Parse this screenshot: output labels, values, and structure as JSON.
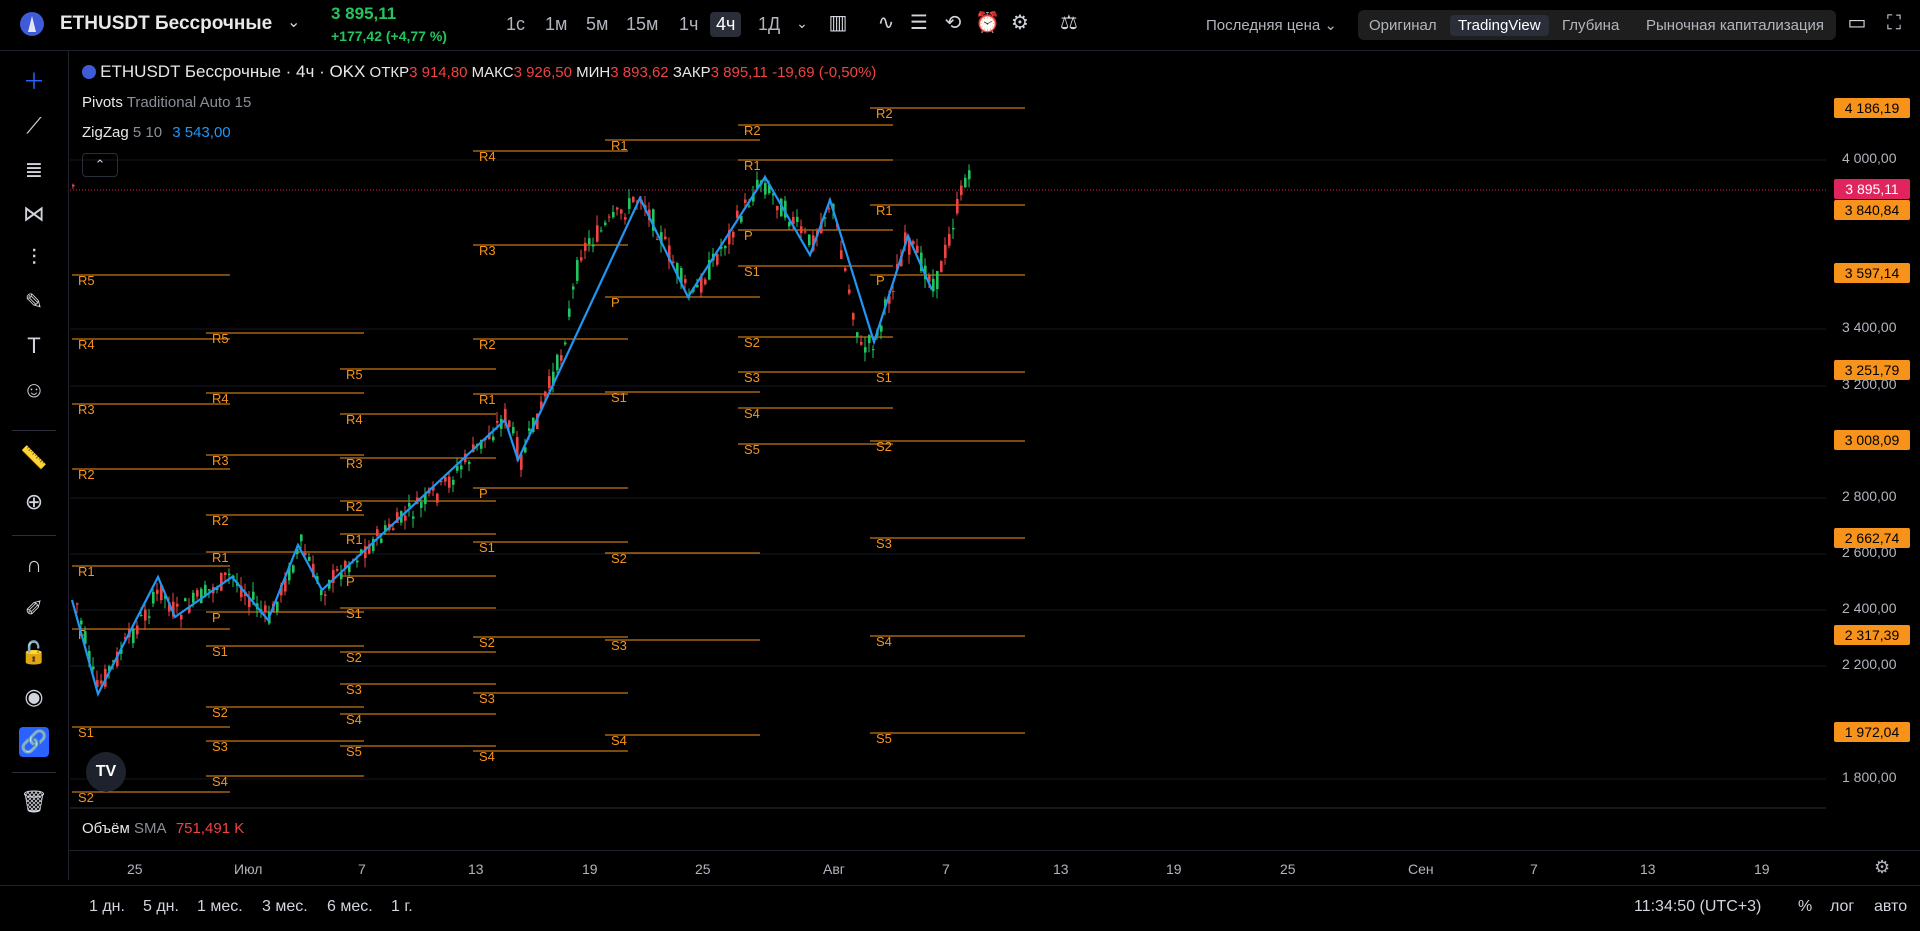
{
  "header": {
    "symbol": "ETHUSDT Бессрочные",
    "price": "3 895,11",
    "change": "+177,42 (+4,77 %)",
    "timeframes": [
      "1с",
      "1м",
      "5м",
      "15м",
      "1ч",
      "4ч",
      "1Д"
    ],
    "active_timeframe": "4ч",
    "price_source": "Последняя цена",
    "modes": [
      "Оригинал",
      "TradingView",
      "Глубина",
      "Рыночная капитализация"
    ],
    "active_mode": "TradingView"
  },
  "legend": {
    "title": "ETHUSDT Бессрочные · 4ч · OKX",
    "open_label": "ОТКР",
    "open": "3 914,80",
    "high_label": "МАКС",
    "high": "3 926,50",
    "low_label": "МИН",
    "low": "3 893,62",
    "close_label": "ЗАКР",
    "close": "3 895,11",
    "close_change": "-19,69 (-0,50%)",
    "pivots_name": "Pivots",
    "pivots_params": "Traditional Auto 15",
    "zigzag_name": "ZigZag",
    "zigzag_params": "5 10",
    "zigzag_value": "3 543,00",
    "volume_name": "Объём",
    "volume_sma": "SMA",
    "volume_value": "751,491 K"
  },
  "price_axis": {
    "labels": [
      "4 000,00",
      "3 400,00",
      "3 200,00",
      "2 800,00",
      "2 600,00",
      "2 400,00",
      "2 200,00",
      "1 800,00"
    ],
    "boxes": [
      {
        "text": "4 186,19",
        "color": "#f7931a"
      },
      {
        "text": "3 895,11",
        "color": "#e0245e"
      },
      {
        "text": "3 840,84",
        "color": "#f7931a"
      },
      {
        "text": "3 597,14",
        "color": "#f7931a"
      },
      {
        "text": "3 251,79",
        "color": "#f7931a"
      },
      {
        "text": "3 008,09",
        "color": "#f7931a"
      },
      {
        "text": "2 662,74",
        "color": "#f7931a"
      },
      {
        "text": "2 317,39",
        "color": "#f7931a"
      },
      {
        "text": "1 972,04",
        "color": "#f7931a"
      }
    ]
  },
  "time_axis": [
    "25",
    "Июл",
    "7",
    "13",
    "19",
    "25",
    "Авг",
    "7",
    "13",
    "19",
    "25",
    "Сен",
    "7",
    "13",
    "19"
  ],
  "bottom": {
    "ranges": [
      "1 дн.",
      "5 дн.",
      "1 мес.",
      "3 мес.",
      "6 мес.",
      "1 г."
    ],
    "clock": "11:34:50 (UTC+3)",
    "percent": "%",
    "log": "лог",
    "auto": "авто"
  },
  "colors": {
    "up": "#22c55e",
    "down": "#ef4444",
    "zigzag": "#2196f3",
    "pivot": "#f7931a"
  },
  "pivot_labels": [
    "R5",
    "R4",
    "R3",
    "R2",
    "R1",
    "P",
    "S1",
    "S2",
    "S3",
    "S4",
    "S5"
  ]
}
